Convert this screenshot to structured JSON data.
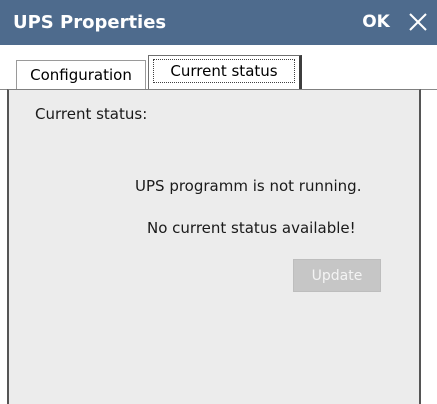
{
  "window": {
    "title": "UPS Properties",
    "ok_label": "OK",
    "title_bar_color": "#4e6b8d"
  },
  "tabs": [
    {
      "label": "Configuration",
      "active": false
    },
    {
      "label": "Current status",
      "active": true
    }
  ],
  "status_panel": {
    "heading": "Current status:",
    "message_running": "UPS programm is not running.",
    "message_status": "No current status available!",
    "update_label": "Update",
    "update_enabled": false
  },
  "icons": {
    "close": "close-icon"
  }
}
